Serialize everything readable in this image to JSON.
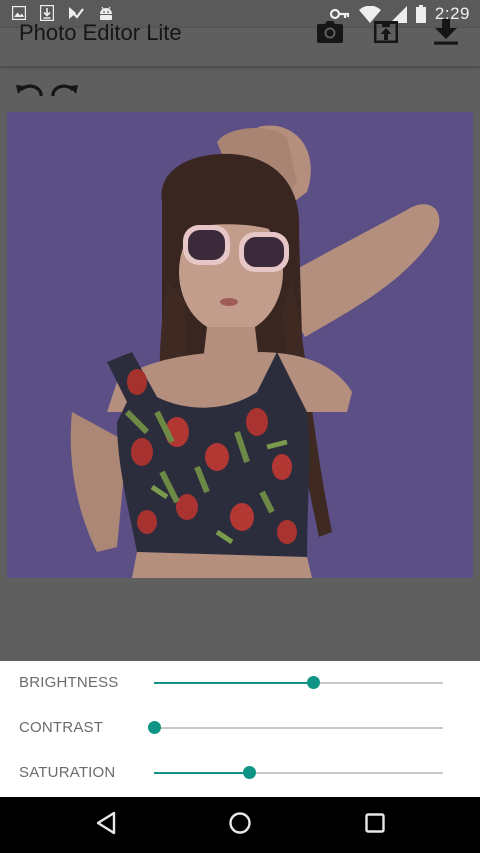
{
  "status_bar": {
    "time": "2:29",
    "left_icons": [
      "gallery-icon",
      "download-notify-icon",
      "checkmark-icon",
      "android-icon"
    ],
    "right_icons": [
      "key-icon",
      "wifi-icon",
      "signal-icon",
      "battery-icon"
    ]
  },
  "app_bar": {
    "title": "Photo Editor Lite",
    "actions": [
      "camera-icon",
      "share-upload-icon",
      "download-icon"
    ]
  },
  "history": {
    "undo": "undo-icon",
    "redo": "redo-icon"
  },
  "photo": {
    "background_color": "#5c4f86"
  },
  "controls": {
    "accent_color": "#0f9486",
    "sliders": [
      {
        "label": "BRIGHTNESS",
        "value": 0.55
      },
      {
        "label": "CONTRAST",
        "value": 0.0
      },
      {
        "label": "SATURATION",
        "value": 0.33
      }
    ]
  },
  "nav_bar": {
    "buttons": [
      "back-icon",
      "home-icon",
      "recents-icon"
    ]
  }
}
